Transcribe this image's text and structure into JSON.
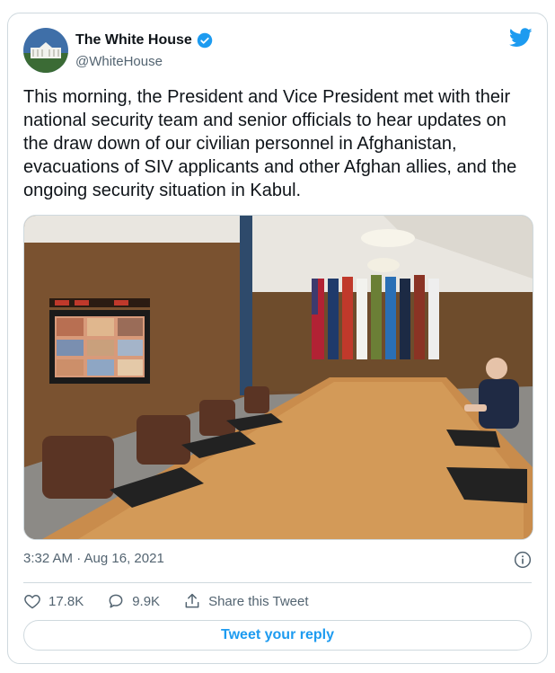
{
  "tweet": {
    "author_name": "The White House",
    "author_handle": "@WhiteHouse",
    "text": "This morning, the President and Vice President met with their national security team and senior officials to hear updates on the draw down of our civilian personnel in Afghanistan, evacuations of SIV applicants and other Afghan allies, and the ongoing security situation in Kabul.",
    "timestamp": "3:32 AM · Aug 16, 2021"
  },
  "actions": {
    "likes": "17.8K",
    "replies": "9.9K",
    "share_label": "Share this Tweet"
  },
  "reply_button": {
    "label": "Tweet your reply"
  },
  "icons": {
    "verified": "verified-badge-icon",
    "brand": "twitter-bird-icon",
    "info": "info-icon",
    "like": "heart-icon",
    "reply": "comment-icon",
    "share": "share-icon"
  },
  "colors": {
    "accent": "#1d9bf0",
    "muted": "#536471",
    "border": "#cfd9de"
  }
}
